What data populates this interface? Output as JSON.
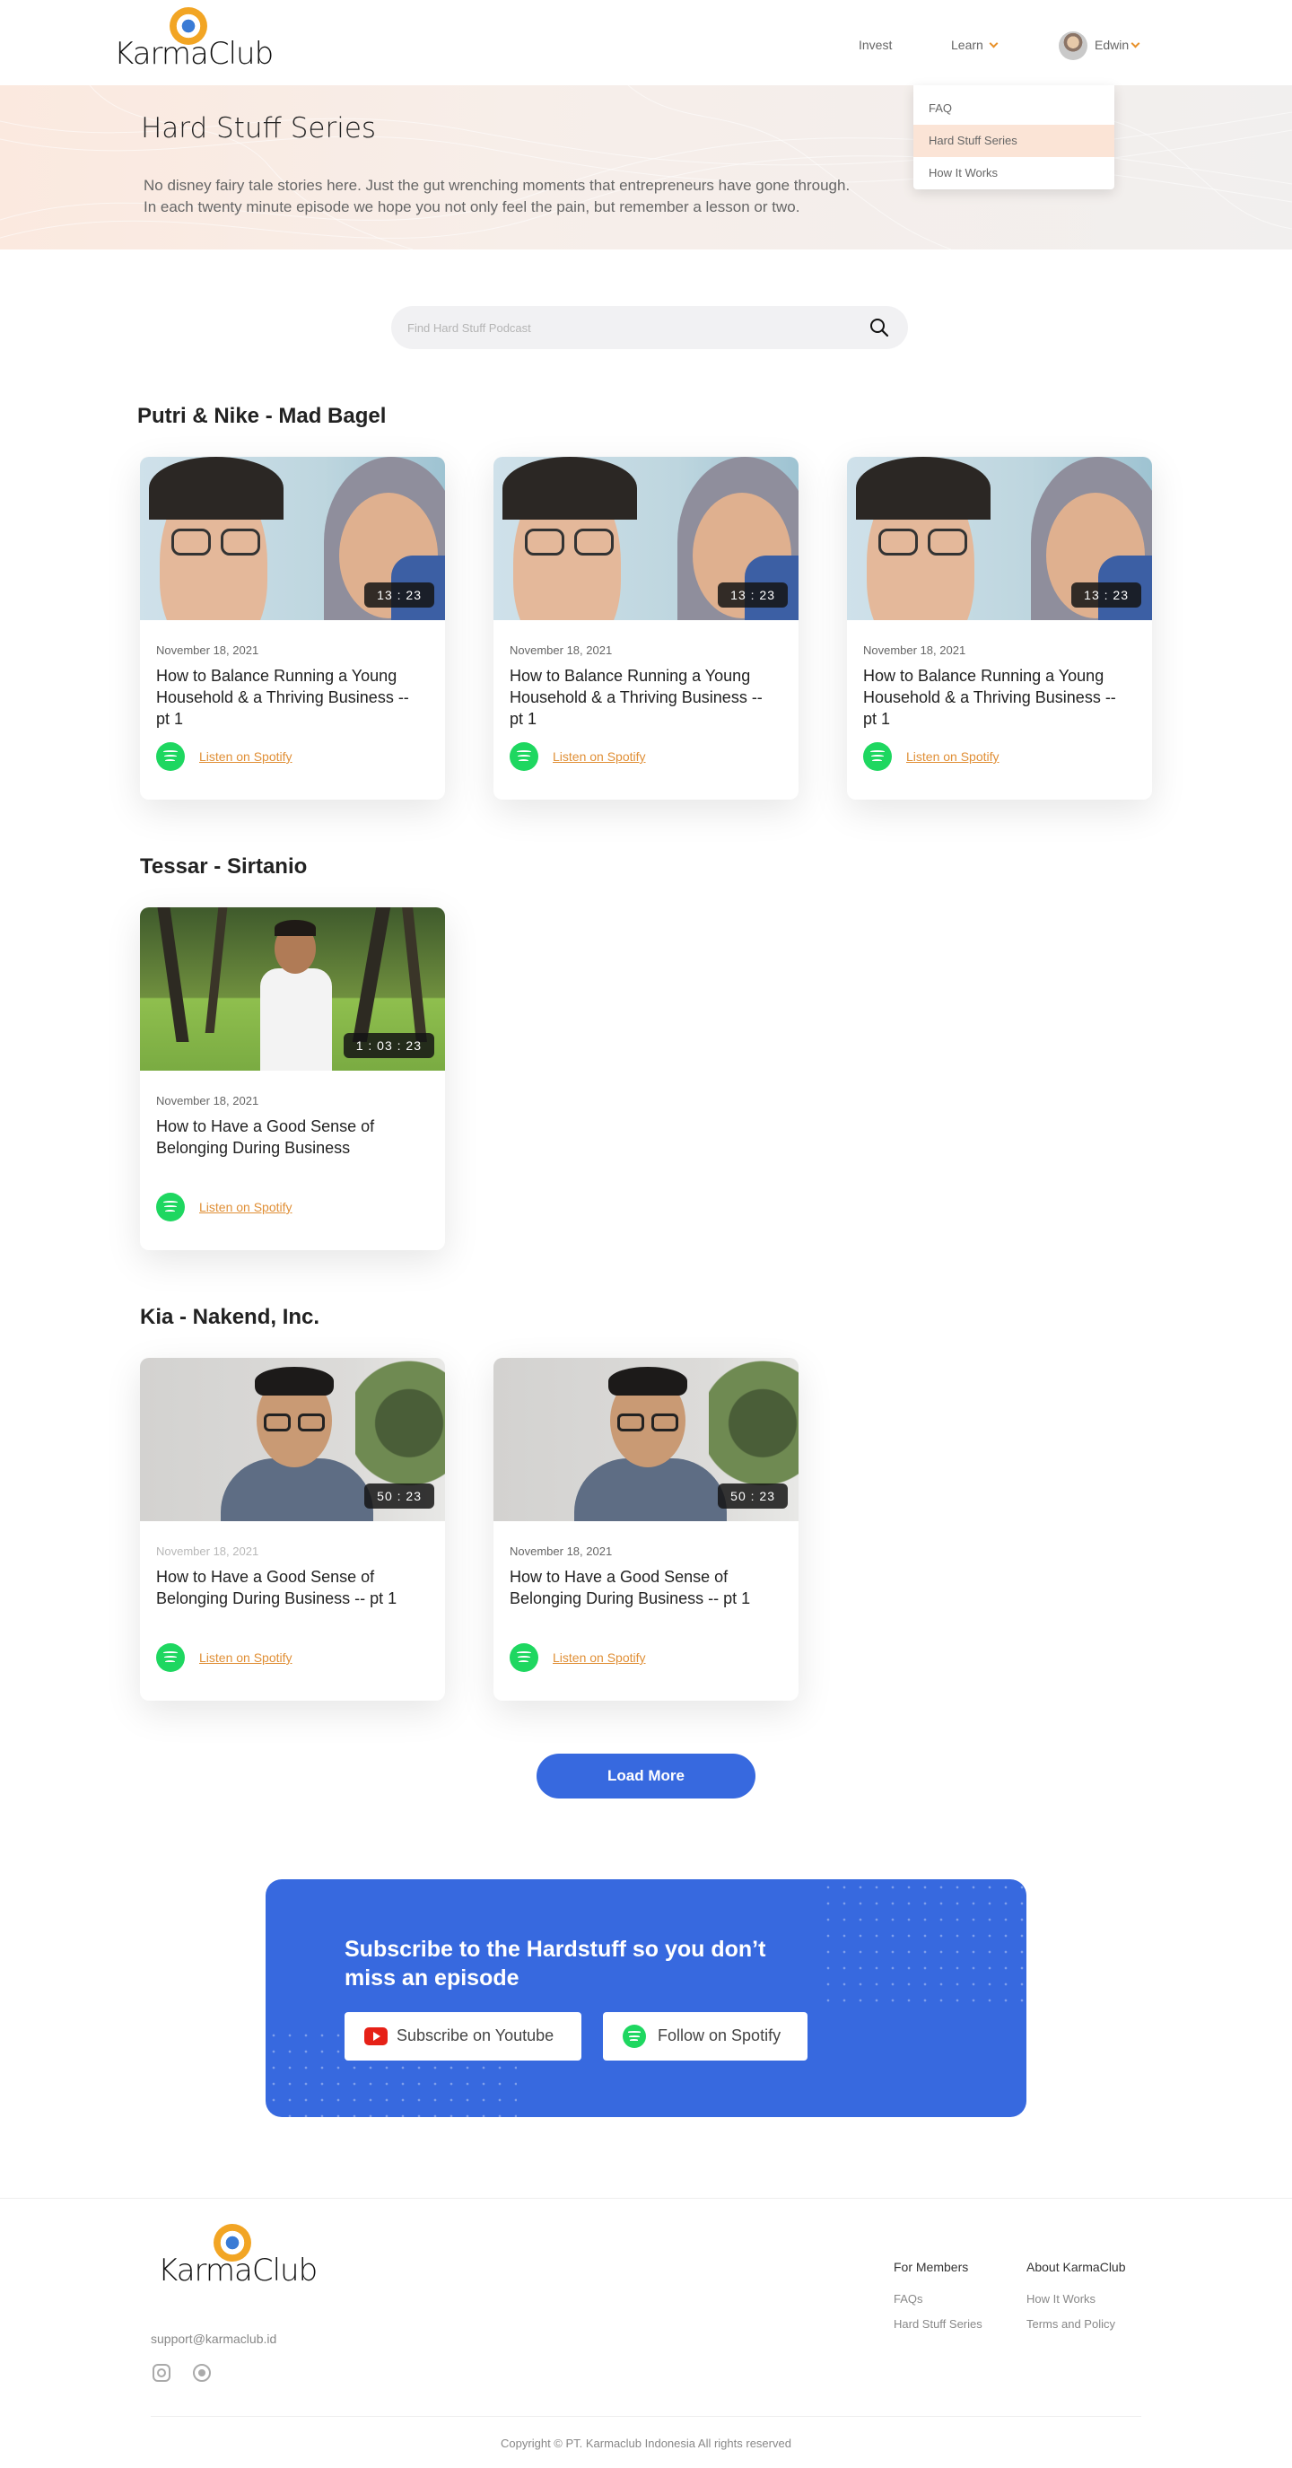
{
  "brand": {
    "name": "KarmaClub"
  },
  "nav": {
    "invest": "Invest",
    "learn": "Learn",
    "user_name": "Edwin",
    "learn_menu": [
      "FAQ",
      "Hard Stuff Series",
      "How It Works"
    ]
  },
  "hero": {
    "title": "Hard Stuff Series",
    "line1": "No disney fairy tale stories here. Just the gut wrenching moments that entrepreneurs have gone through.",
    "line2": "In each twenty minute episode we hope you not only feel the pain, but remember a lesson or two."
  },
  "search": {
    "placeholder": "Find Hard Stuff Podcast"
  },
  "sections": [
    {
      "title": "Putri & Nike - Mad Bagel",
      "episodes": [
        {
          "duration": "13 : 23",
          "date": "November 18, 2021",
          "title": "How to Balance Running a Young Household & a Thriving Business -- pt 1",
          "link": "Listen on Spotify"
        },
        {
          "duration": "13 : 23",
          "date": "November 18, 2021",
          "title": "How to Balance Running a Young Household & a Thriving Business -- pt 1",
          "link": "Listen on Spotify"
        },
        {
          "duration": "13 : 23",
          "date": "November 18, 2021",
          "title": "How to Balance Running a Young Household & a Thriving Business -- pt 1",
          "link": "Listen on Spotify"
        }
      ]
    },
    {
      "title": "Tessar - Sirtanio",
      "episodes": [
        {
          "duration": "1 : 03 : 23",
          "date": "November 18, 2021",
          "title": "How to Have a Good Sense of Belonging During Business",
          "link": "Listen on Spotify"
        }
      ]
    },
    {
      "title": "Kia - Nakend, Inc.",
      "episodes": [
        {
          "duration": "50 : 23",
          "date": "November 18, 2021",
          "title": "How to Have a Good Sense of Belonging During Business -- pt 1",
          "link": "Listen on Spotify"
        },
        {
          "duration": "50 : 23",
          "date": "November 18, 2021",
          "title": "How to Have a Good Sense of Belonging During Business -- pt 1",
          "link": "Listen on Spotify"
        }
      ]
    }
  ],
  "load_more": "Load More",
  "subscribe": {
    "title": "Subscribe to the Hardstuff  so you don’t miss an episode",
    "youtube": "Subscribe on Youtube",
    "spotify": "Follow on Spotify"
  },
  "footer": {
    "email": "support@karmaclub.id",
    "members_heading": "For Members",
    "members_links": [
      "FAQs",
      "Hard Stuff Series"
    ],
    "about_heading": "About KarmaClub",
    "about_links": [
      "How It Works",
      "Terms and Policy"
    ],
    "copyright": "Copyright © PT. Karmaclub Indonesia All rights reserved"
  },
  "colors": {
    "primary": "#3769df",
    "accent": "#e08f36",
    "spotify": "#1ed760",
    "youtube": "#e62117"
  },
  "icons": [
    "logo-ring-icon",
    "chevron-down-icon",
    "search-icon",
    "spotify-icon",
    "youtube-icon",
    "instagram-icon",
    "whatsapp-icon"
  ]
}
